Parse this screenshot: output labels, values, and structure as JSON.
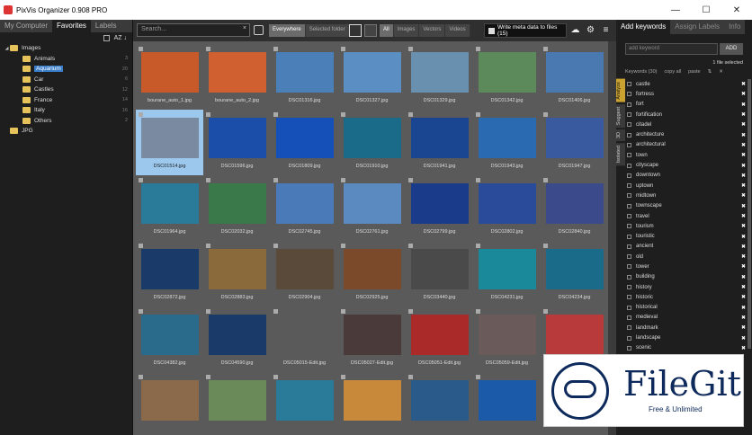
{
  "app": {
    "title": "PixVis Organizer 0.908 PRO"
  },
  "window_controls": {
    "minimize": "—",
    "maximize": "☐",
    "close": "✕"
  },
  "left_panel": {
    "tabs": [
      "My Computer",
      "Favorites",
      "Labels"
    ],
    "sort_label": "AZ ↓",
    "tree": [
      {
        "label": "Images",
        "level": 0,
        "count": "",
        "expanded": true
      },
      {
        "label": "Animals",
        "level": 1,
        "count": "3"
      },
      {
        "label": "Aquarium",
        "level": 1,
        "count": "20",
        "selected": true
      },
      {
        "label": "Car",
        "level": 1,
        "count": "6"
      },
      {
        "label": "Castles",
        "level": 1,
        "count": "12"
      },
      {
        "label": "France",
        "level": 1,
        "count": "14"
      },
      {
        "label": "Italy",
        "level": 1,
        "count": "16"
      },
      {
        "label": "Others",
        "level": 1,
        "count": "2"
      },
      {
        "label": "JPG",
        "level": 0,
        "count": ""
      }
    ]
  },
  "toolbar": {
    "search_placeholder": "Search...",
    "scope": [
      "Everywhere",
      "Selected folder"
    ],
    "filter": [
      "All",
      "Images",
      "Vectors",
      "Videos"
    ],
    "write_meta_label": "Write meta data to files (15)"
  },
  "thumbnails": [
    {
      "caption": "bourane_auto_1.jpg",
      "color": "#c85a2a"
    },
    {
      "caption": "bourane_auto_2.jpg",
      "color": "#d06030"
    },
    {
      "caption": "DSC01316.jpg",
      "color": "#4a7fb8"
    },
    {
      "caption": "DSC01327.jpg",
      "color": "#5b8fc4"
    },
    {
      "caption": "DSC01329.jpg",
      "color": "#6a90b0"
    },
    {
      "caption": "DSC01342.jpg",
      "color": "#5c8a5a"
    },
    {
      "caption": "DSC01406.jpg",
      "color": "#4a78b0"
    },
    {
      "caption": "DSC01514.jpg",
      "color": "#7a8aa0",
      "selected": true
    },
    {
      "caption": "DSC01596.jpg",
      "color": "#1a4ea8"
    },
    {
      "caption": "DSC01809.jpg",
      "color": "#1450b8"
    },
    {
      "caption": "DSC01910.jpg",
      "color": "#1a6a8a"
    },
    {
      "caption": "DSC01941.jpg",
      "color": "#1a4590"
    },
    {
      "caption": "DSC01943.jpg",
      "color": "#2a6ab0"
    },
    {
      "caption": "DSC01947.jpg",
      "color": "#3a5aa0"
    },
    {
      "caption": "DSC01964.jpg",
      "color": "#2a7a9a"
    },
    {
      "caption": "DSC02032.jpg",
      "color": "#3a7a4a"
    },
    {
      "caption": "DSC02745.jpg",
      "color": "#4a7ab8"
    },
    {
      "caption": "DSC02761.jpg",
      "color": "#5a8ac0"
    },
    {
      "caption": "DSC02799.jpg",
      "color": "#1a3a8a"
    },
    {
      "caption": "DSC02802.jpg",
      "color": "#2a4a9a"
    },
    {
      "caption": "DSC02840.jpg",
      "color": "#3a4a8a"
    },
    {
      "caption": "DSC02872.jpg",
      "color": "#1a3a6a"
    },
    {
      "caption": "DSC02883.jpg",
      "color": "#8a6a3a"
    },
    {
      "caption": "DSC02904.jpg",
      "color": "#5a4a3a"
    },
    {
      "caption": "DSC02925.jpg",
      "color": "#7a4a2a"
    },
    {
      "caption": "DSC03440.jpg",
      "color": "#4a4a4a"
    },
    {
      "caption": "DSC04231.jpg",
      "color": "#1a8a9a"
    },
    {
      "caption": "DSC04234.jpg",
      "color": "#1a6a8a"
    },
    {
      "caption": "DSC04382.jpg",
      "color": "#2a6a8a"
    },
    {
      "caption": "DSC04590.jpg",
      "color": "#1a3a6a"
    },
    {
      "caption": "DSC05015-Edit.jpg",
      "color": "#5a5a5a"
    },
    {
      "caption": "DSC05027-Edit.jpg",
      "color": "#4a3a3a"
    },
    {
      "caption": "DSC05051-Edit.jpg",
      "color": "#aa2a2a"
    },
    {
      "caption": "DSC05059-Edit.jpg",
      "color": "#6a5a5a"
    },
    {
      "caption": "DSC05060-Edit.jpg",
      "color": "#b83a3a"
    },
    {
      "caption": "",
      "color": "#8a6a4a"
    },
    {
      "caption": "",
      "color": "#6a8a5a"
    },
    {
      "caption": "",
      "color": "#2a7a9a"
    },
    {
      "caption": "",
      "color": "#c88a3a"
    },
    {
      "caption": "",
      "color": "#2a5a8a"
    },
    {
      "caption": "",
      "color": "#1a5aa8"
    }
  ],
  "right_panel": {
    "tabs": [
      "Add keywords",
      "Assign Labels",
      "Info"
    ],
    "add_placeholder": "add keyword",
    "add_button": "ADD",
    "files_selected": "1 file selected",
    "keywords_header": "Keywords (30)",
    "copy_all": "copy all",
    "paste": "paste",
    "vertical_tabs": [
      "Analyze",
      "Suggest",
      "3D",
      "Isolated"
    ],
    "keywords": [
      "castle",
      "fortress",
      "fort",
      "fortification",
      "citadel",
      "architecture",
      "architectural",
      "town",
      "cityscape",
      "downtown",
      "uptown",
      "midtown",
      "townscape",
      "travel",
      "tourism",
      "touristic",
      "ancient",
      "old",
      "tower",
      "building",
      "history",
      "historic",
      "historical",
      "medieval",
      "landmark",
      "landscape",
      "scenic"
    ]
  },
  "watermark": {
    "name": "FileGit",
    "tagline": "Free & Unlimited"
  }
}
